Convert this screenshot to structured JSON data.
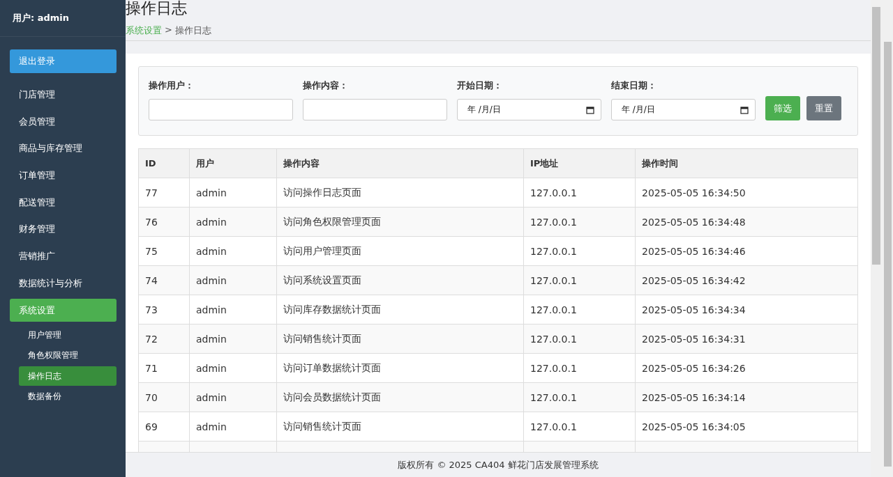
{
  "sidebar": {
    "user_label": "用户: admin",
    "logout_button": "退出登录",
    "items": [
      {
        "label": "门店管理",
        "selected": false
      },
      {
        "label": "会员管理",
        "selected": false
      },
      {
        "label": "商品与库存管理",
        "selected": false
      },
      {
        "label": "订单管理",
        "selected": false
      },
      {
        "label": "配送管理",
        "selected": false
      },
      {
        "label": "财务管理",
        "selected": false
      },
      {
        "label": "营销推广",
        "selected": false
      },
      {
        "label": "数据统计与分析",
        "selected": false
      },
      {
        "label": "系统设置",
        "selected": true,
        "children": [
          {
            "label": "用户管理",
            "selected": false
          },
          {
            "label": "角色权限管理",
            "selected": false
          },
          {
            "label": "操作日志",
            "selected": true
          },
          {
            "label": "数据备份",
            "selected": false
          }
        ]
      }
    ]
  },
  "page": {
    "title": "操作日志",
    "breadcrumb": [
      {
        "label": "系统设置",
        "kind": "link"
      },
      {
        "label": ">",
        "kind": "separator"
      },
      {
        "label": "操作日志",
        "kind": "current"
      }
    ]
  },
  "filters": [
    {
      "label": "操作用户：",
      "kind": "text"
    },
    {
      "label": "操作内容：",
      "kind": "text"
    },
    {
      "label": "开始日期：",
      "kind": "date",
      "value": "年 /月/日"
    },
    {
      "label": "结束日期：",
      "kind": "date",
      "value": "年 /月/日"
    }
  ],
  "buttons": [
    {
      "label": "筛选",
      "kind": "primary"
    },
    {
      "label": "重置",
      "kind": "secondary"
    }
  ],
  "table": {
    "columns": [
      "ID",
      "用户",
      "操作内容",
      "IP地址",
      "操作时间"
    ],
    "rows": [
      [
        "77",
        "admin",
        "访问操作日志页面",
        "127.0.0.1",
        "2025-05-05 16:34:50"
      ],
      [
        "76",
        "admin",
        "访问角色权限管理页面",
        "127.0.0.1",
        "2025-05-05 16:34:48"
      ],
      [
        "75",
        "admin",
        "访问用户管理页面",
        "127.0.0.1",
        "2025-05-05 16:34:46"
      ],
      [
        "74",
        "admin",
        "访问系统设置页面",
        "127.0.0.1",
        "2025-05-05 16:34:42"
      ],
      [
        "73",
        "admin",
        "访问库存数据统计页面",
        "127.0.0.1",
        "2025-05-05 16:34:34"
      ],
      [
        "72",
        "admin",
        "访问销售统计页面",
        "127.0.0.1",
        "2025-05-05 16:34:31"
      ],
      [
        "71",
        "admin",
        "访问订单数据统计页面",
        "127.0.0.1",
        "2025-05-05 16:34:26"
      ],
      [
        "70",
        "admin",
        "访问会员数据统计页面",
        "127.0.0.1",
        "2025-05-05 16:34:14"
      ],
      [
        "69",
        "admin",
        "访问销售统计页面",
        "127.0.0.1",
        "2025-05-05 16:34:05"
      ]
    ]
  },
  "footer": "版权所有 © 2025 CA404 鲜花门店发展管理系统"
}
